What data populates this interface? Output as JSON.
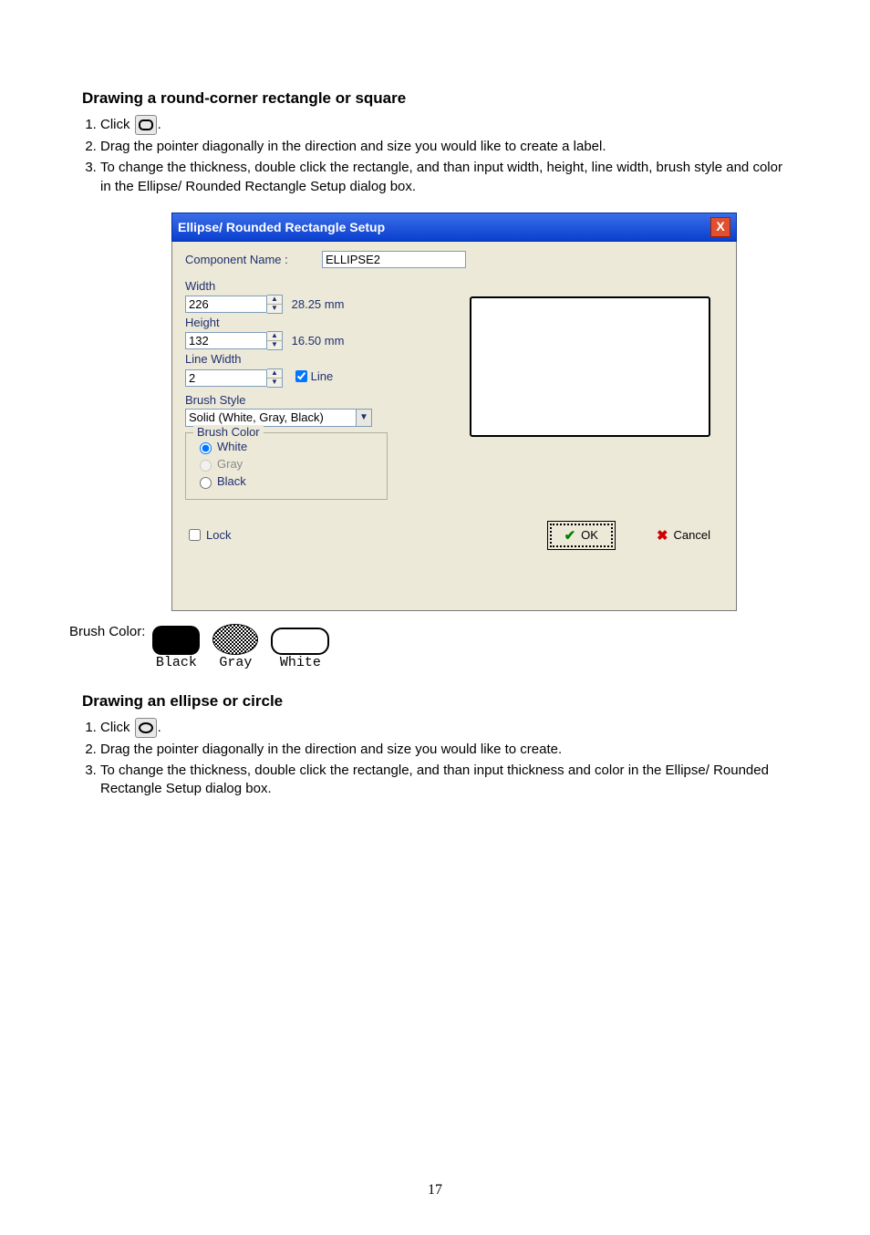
{
  "h1_a": "Drawing a round-corner rectangle or square",
  "steps_a": {
    "s1_a": "Click ",
    "s1_b": ".",
    "s2": "Drag the pointer diagonally in the direction and size you would like to create a label.",
    "s3": "To change the thickness, double click the rectangle, and than input width, height, line width, brush style and color in the Ellipse/ Rounded Rectangle Setup dialog box."
  },
  "dialog": {
    "title": "Ellipse/ Rounded Rectangle Setup",
    "close": "X",
    "component_label": "Component Name :",
    "component_value": "ELLIPSE2",
    "width_label": "Width",
    "width_value": "226",
    "width_mm": "28.25 mm",
    "height_label": "Height",
    "height_value": "132",
    "height_mm": "16.50 mm",
    "linewidth_label": "Line Width",
    "linewidth_value": "2",
    "line_checkbox": "Line",
    "brushstyle_label": "Brush Style",
    "brushstyle_value": "Solid (White, Gray, Black)",
    "brushcolor_legend": "Brush Color",
    "bc_white": "White",
    "bc_gray": "Gray",
    "bc_black": "Black",
    "lock": "Lock",
    "ok": "OK",
    "cancel": "Cancel"
  },
  "bc_label": "Brush Color:",
  "bc_swatches": {
    "black": "Black",
    "gray": "Gray",
    "white": "White"
  },
  "h1_b": "Drawing an ellipse or circle",
  "steps_b": {
    "s1_a": "Click ",
    "s1_b": ".",
    "s2": "Drag the pointer diagonally in the direction and size you would like to create.",
    "s3": "To change the thickness, double click the rectangle, and than input thickness and color in the Ellipse/ Rounded Rectangle Setup dialog box."
  },
  "page_number": "17"
}
